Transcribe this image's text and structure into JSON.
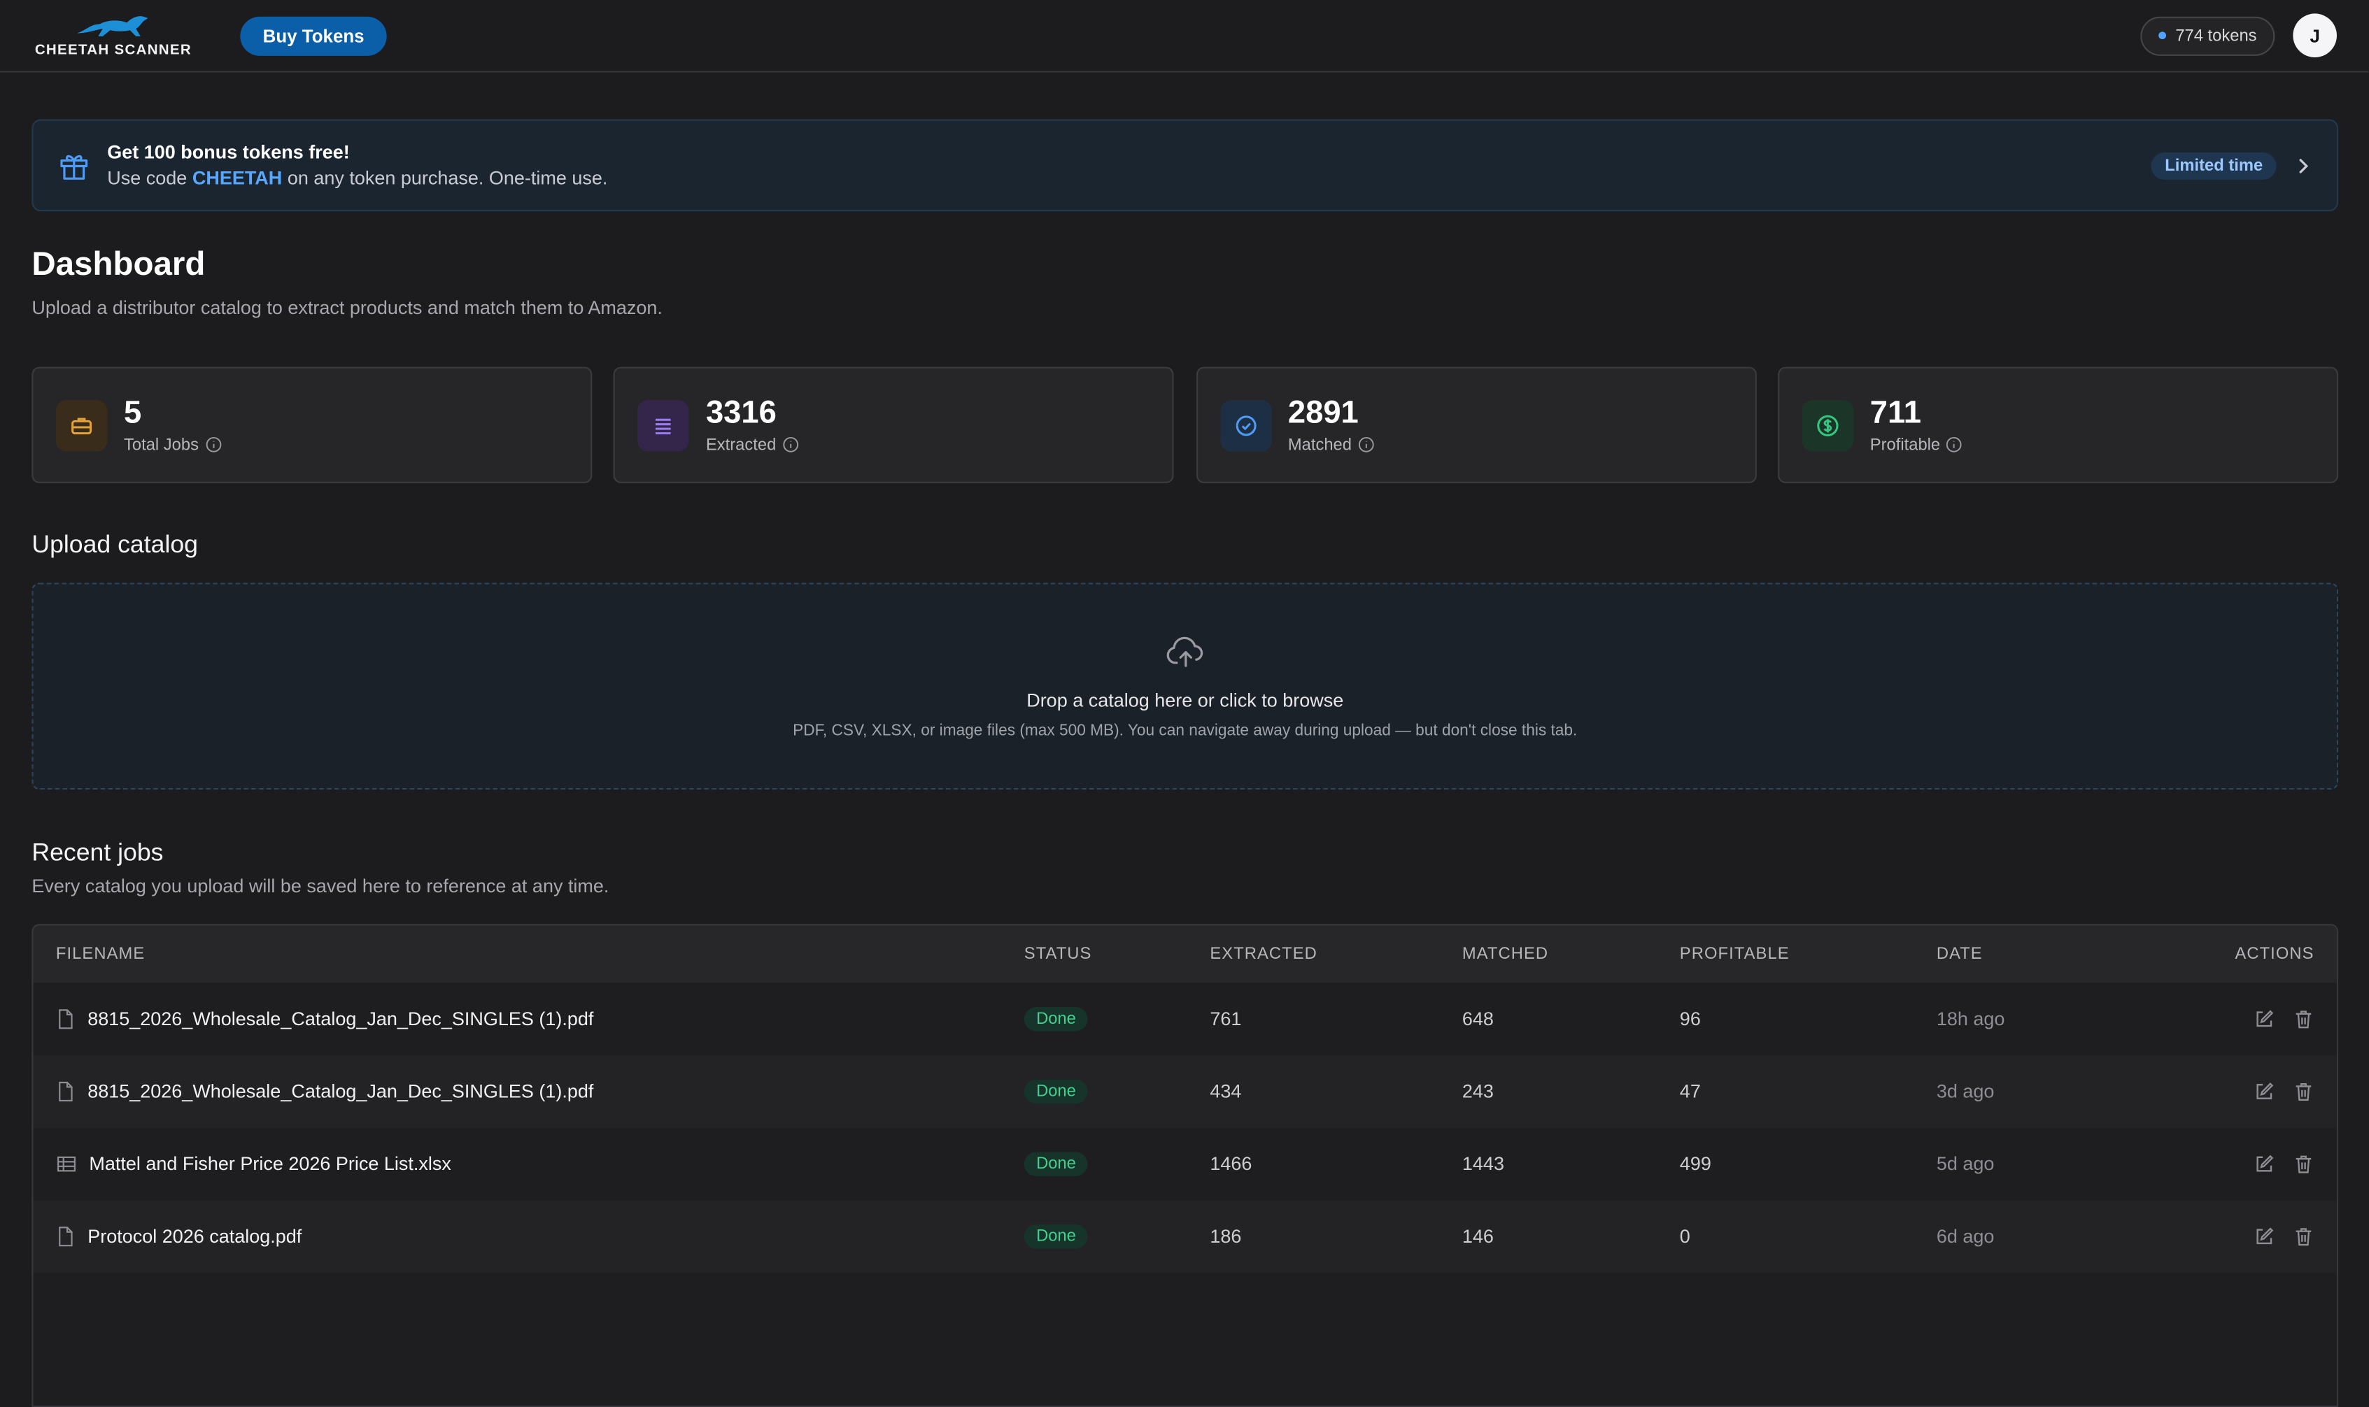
{
  "header": {
    "brand_name": "CHEETAH SCANNER",
    "buy_label": "Buy Tokens",
    "tokens": "774 tokens",
    "avatar_initial": "J"
  },
  "promo": {
    "title": "Get 100 bonus tokens free!",
    "sub_prefix": "Use code",
    "code": "CHEETAH",
    "sub_suffix": "on any token purchase. One-time use.",
    "badge": "Limited time"
  },
  "page": {
    "title": "Dashboard",
    "subtitle": "Upload a distributor catalog to extract products and match them to Amazon."
  },
  "stats": [
    {
      "value": "5",
      "label": "Total Jobs",
      "icon": "briefcase-icon",
      "color": "#e3a33a",
      "bg": "#3a2c1a"
    },
    {
      "value": "3316",
      "label": "Extracted",
      "icon": "list-icon",
      "color": "#9a7cf0",
      "bg": "#33264a"
    },
    {
      "value": "2891",
      "label": "Matched",
      "icon": "check-circle-icon",
      "color": "#4f9bf5",
      "bg": "#1d2f45"
    },
    {
      "value": "711",
      "label": "Profitable",
      "icon": "dollar-icon",
      "color": "#34c77f",
      "bg": "#1b3629"
    }
  ],
  "upload": {
    "section_title": "Upload catalog",
    "title": "Drop a catalog here or click to browse",
    "sub": "PDF, CSV, XLSX, or image files (max 500 MB). You can navigate away during upload — but don't close this tab."
  },
  "jobs": {
    "section_title": "Recent jobs",
    "subtitle": "Every catalog you upload will be saved here to reference at any time.",
    "columns": [
      "FILENAME",
      "STATUS",
      "EXTRACTED",
      "MATCHED",
      "PROFITABLE",
      "DATE",
      "ACTIONS"
    ],
    "rows": [
      {
        "file": "8815_2026_Wholesale_Catalog_Jan_Dec_SINGLES (1).pdf",
        "icon": "file-icon",
        "status": "Done",
        "extracted": "761",
        "matched": "648",
        "profitable": "96",
        "date": "18h ago"
      },
      {
        "file": "8815_2026_Wholesale_Catalog_Jan_Dec_SINGLES (1).pdf",
        "icon": "file-icon",
        "status": "Done",
        "extracted": "434",
        "matched": "243",
        "profitable": "47",
        "date": "3d ago"
      },
      {
        "file": "Mattel and Fisher Price 2026 Price List.xlsx",
        "icon": "spreadsheet-icon",
        "status": "Done",
        "extracted": "1466",
        "matched": "1443",
        "profitable": "499",
        "date": "5d ago"
      },
      {
        "file": "Protocol 2026 catalog.pdf",
        "icon": "file-icon",
        "status": "Done",
        "extracted": "186",
        "matched": "146",
        "profitable": "0",
        "date": "6d ago"
      }
    ]
  },
  "colors": {
    "accent": "#0b5ea8",
    "code_link": "#58a8ff",
    "status_done": "#43cf8e"
  }
}
